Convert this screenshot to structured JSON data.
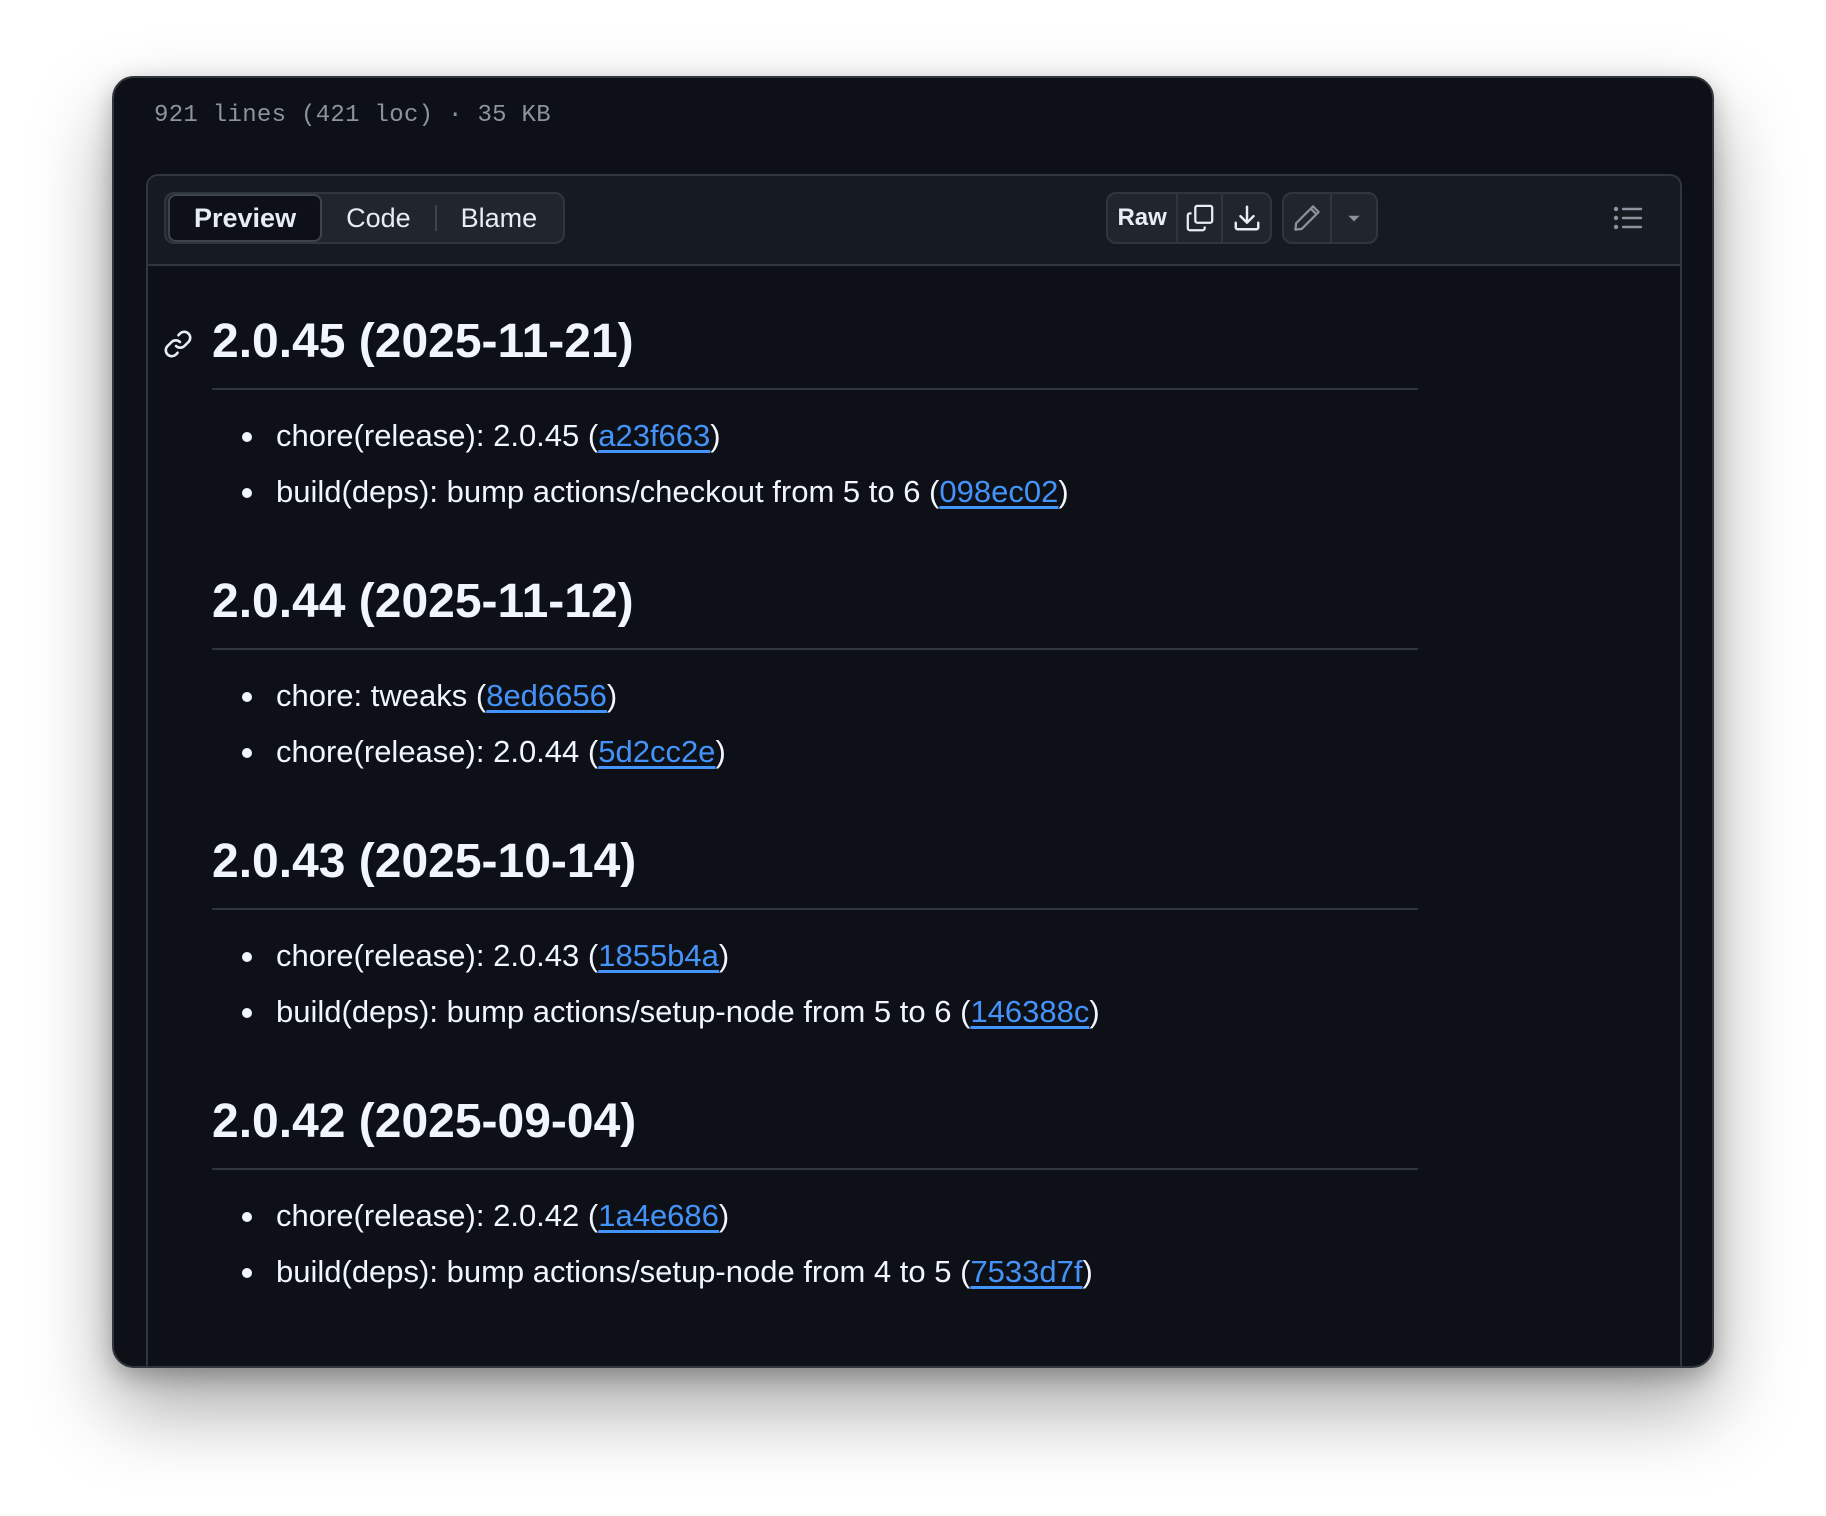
{
  "file_meta": "921 lines (421 loc) · 35 KB",
  "tabs": [
    {
      "label": "Preview",
      "active": true
    },
    {
      "label": "Code",
      "active": false
    },
    {
      "label": "Blame",
      "active": false
    }
  ],
  "toolbar": {
    "raw_label": "Raw",
    "copy_icon": "copy-icon",
    "download_icon": "download-icon",
    "edit_icon": "pencil-icon",
    "more_icon": "triangle-down-icon",
    "outline_icon": "list-unordered-icon"
  },
  "colors": {
    "background": "#0d1117",
    "link": "#4493f8",
    "text": "#f0f6fc",
    "border": "#30363d"
  },
  "releases": [
    {
      "heading": "2.0.45 (2025-11-21)",
      "items": [
        {
          "prefix": "chore(release): 2.0.45 (",
          "commit": "a23f663",
          "suffix": ")"
        },
        {
          "prefix": "build(deps): bump actions/checkout from 5 to 6 (",
          "commit": "098ec02",
          "suffix": ")"
        }
      ]
    },
    {
      "heading": "2.0.44 (2025-11-12)",
      "items": [
        {
          "prefix": "chore: tweaks (",
          "commit": "8ed6656",
          "suffix": ")"
        },
        {
          "prefix": "chore(release): 2.0.44 (",
          "commit": "5d2cc2e",
          "suffix": ")"
        }
      ]
    },
    {
      "heading": "2.0.43 (2025-10-14)",
      "items": [
        {
          "prefix": "chore(release): 2.0.43 (",
          "commit": "1855b4a",
          "suffix": ")"
        },
        {
          "prefix": "build(deps): bump actions/setup-node from 5 to 6 (",
          "commit": "146388c",
          "suffix": ")"
        }
      ]
    },
    {
      "heading": "2.0.42 (2025-09-04)",
      "items": [
        {
          "prefix": "chore(release): 2.0.42 (",
          "commit": "1a4e686",
          "suffix": ")"
        },
        {
          "prefix": "build(deps): bump actions/setup-node from 4 to 5 (",
          "commit": "7533d7f",
          "suffix": ")"
        }
      ]
    }
  ]
}
